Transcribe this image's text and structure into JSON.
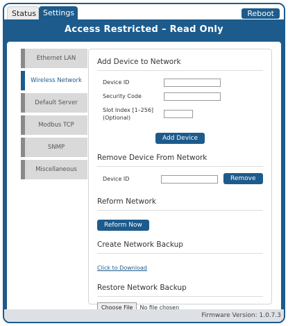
{
  "tabs": {
    "status": "Status",
    "settings": "Settings"
  },
  "reboot_label": "Reboot",
  "page_title": "Access Restricted – Read Only",
  "sidebar": {
    "items": [
      {
        "label": "Ethernet LAN",
        "active": false
      },
      {
        "label": "Wireless Network",
        "active": true
      },
      {
        "label": "Default Server",
        "active": false
      },
      {
        "label": "Modbus TCP",
        "active": false
      },
      {
        "label": "SNMP",
        "active": false
      },
      {
        "label": "Miscellaneous",
        "active": false
      }
    ]
  },
  "add_device": {
    "title": "Add Device to Network",
    "device_id_label": "Device ID",
    "security_code_label": "Security Code",
    "slot_index_label": "Slot Index [1–256]",
    "slot_index_optional": "(Optional)",
    "button": "Add Device"
  },
  "remove_device": {
    "title": "Remove Device From Network",
    "device_id_label": "Device ID",
    "button": "Remove"
  },
  "reform": {
    "title": "Reform Network",
    "button": "Reform Now"
  },
  "backup": {
    "title": "Create Network Backup",
    "link": "Click to Download"
  },
  "restore": {
    "title": "Restore Network Backup",
    "choose_file": "Choose File",
    "no_file": "No file chosen"
  },
  "footer": {
    "firmware": "Firmware Version: 1.0.7.3"
  }
}
